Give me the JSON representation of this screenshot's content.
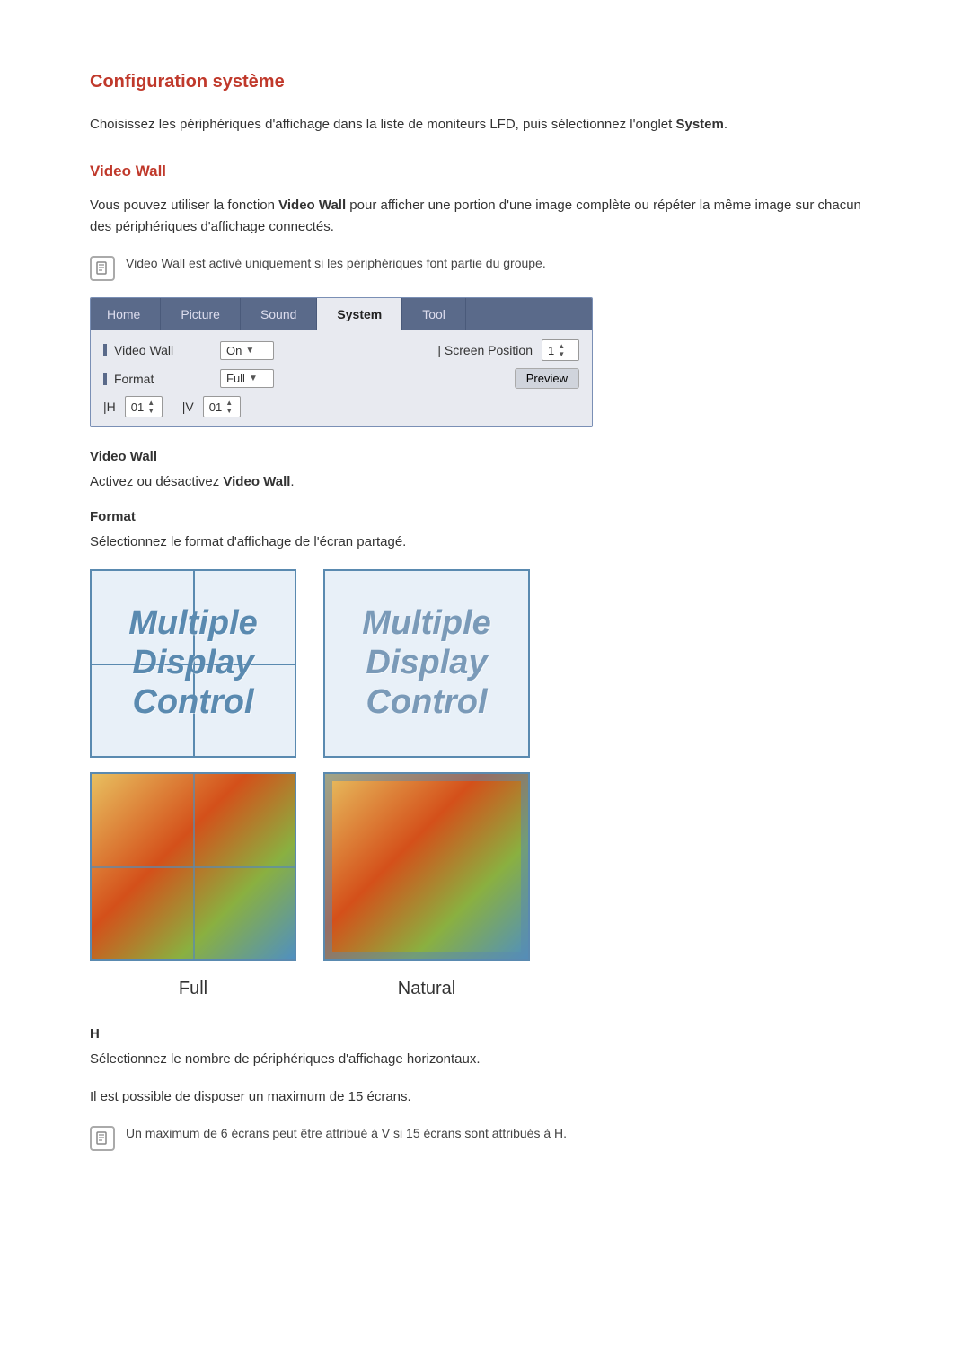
{
  "page": {
    "title": "Configuration système",
    "intro": "Choisissez les périphériques d'affichage dans la liste de moniteurs LFD, puis sélectionnez l'onglet ",
    "intro_bold": "System",
    "intro_end": "."
  },
  "videowall_section": {
    "title": "Video Wall",
    "description_start": "Vous pouvez utiliser la fonction ",
    "description_bold": "Video Wall",
    "description_end": " pour afficher une portion d'une image complète ou répéter la même image sur chacun des périphériques d'affichage connectés.",
    "note": "Video Wall est activé uniquement si les périphériques font partie du groupe."
  },
  "panel": {
    "tabs": [
      "Home",
      "Picture",
      "Sound",
      "System",
      "Tool"
    ],
    "active_tab": "System",
    "rows": [
      {
        "label": "Video Wall",
        "control": "On",
        "right_label": "Screen Position",
        "right_value": "1"
      },
      {
        "label": "Format",
        "control": "Full",
        "right_btn": "Preview"
      },
      {
        "h_label": "H",
        "h_value": "01",
        "v_label": "V",
        "v_value": "01"
      }
    ]
  },
  "sub_sections": {
    "videowall": {
      "label": "Video Wall",
      "desc_start": "Activez ou désactivez ",
      "desc_bold": "Video Wall",
      "desc_end": "."
    },
    "format": {
      "label": "Format",
      "desc": "Sélectionnez le format d'affichage de l'écran partagé."
    },
    "full_caption": "Full",
    "natural_caption": "Natural",
    "h_section": {
      "label": "H",
      "desc1": "Sélectionnez le nombre de périphériques d'affichage horizontaux.",
      "desc2": "Il est possible de disposer un maximum de 15 écrans.",
      "note": "Un maximum de 6 écrans peut être attribué à V si 15 écrans sont attribués à H."
    }
  }
}
